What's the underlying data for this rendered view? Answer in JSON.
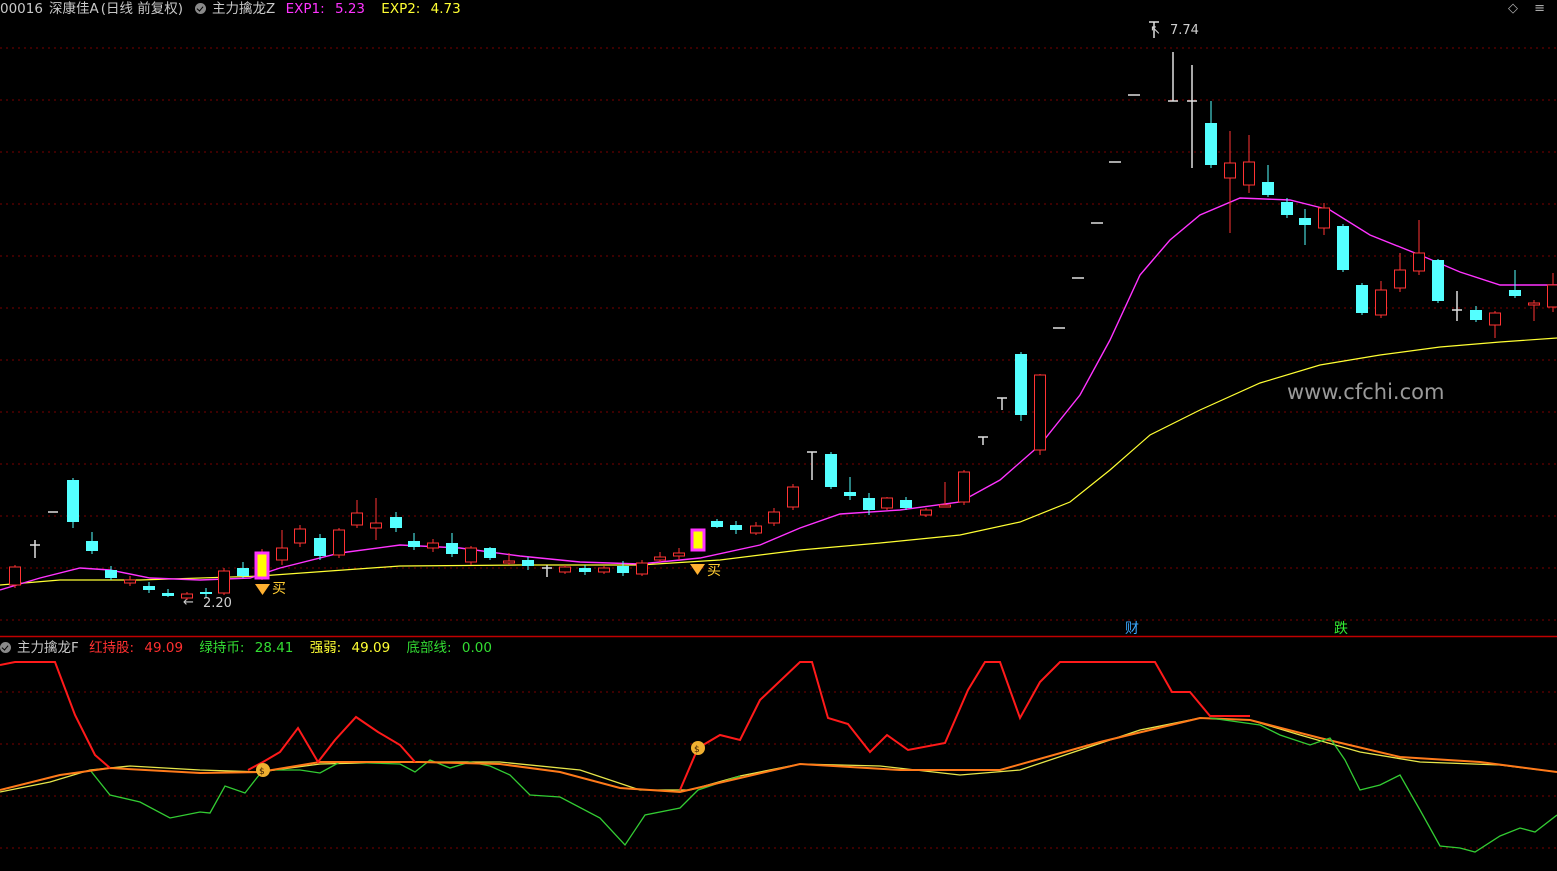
{
  "top_panel": {
    "code": "00016",
    "stock_name": "深康佳A",
    "period_info": "(日线 前复权)",
    "indicator_name": "主力擒龙Z",
    "exp1_label": "EXP1:",
    "exp1_value": "5.23",
    "exp2_label": "EXP2:",
    "exp2_value": "4.73",
    "high_marker": "7.74",
    "low_marker": "2.20",
    "buy_label": "买",
    "signal_cai": "财",
    "signal_die": "跌",
    "watermark": "www.cfchi.com",
    "window_controls": "◇ ≡"
  },
  "bottom_panel": {
    "indicator_name": "主力擒龙F",
    "red_label": "红持股:",
    "red_value": "49.09",
    "green_label": "绿持币:",
    "green_value": "28.41",
    "strength_label": "强弱:",
    "strength_value": "49.09",
    "bottom_label": "底部线:",
    "bottom_value": "0.00"
  },
  "colors": {
    "bg": "#000000",
    "up_candle": "#ff3333",
    "down_candle": "#54ffff",
    "exp1": "#ff33ff",
    "exp2": "#ffff33",
    "grid": "#7a0000",
    "divider": "#c00000"
  }
}
